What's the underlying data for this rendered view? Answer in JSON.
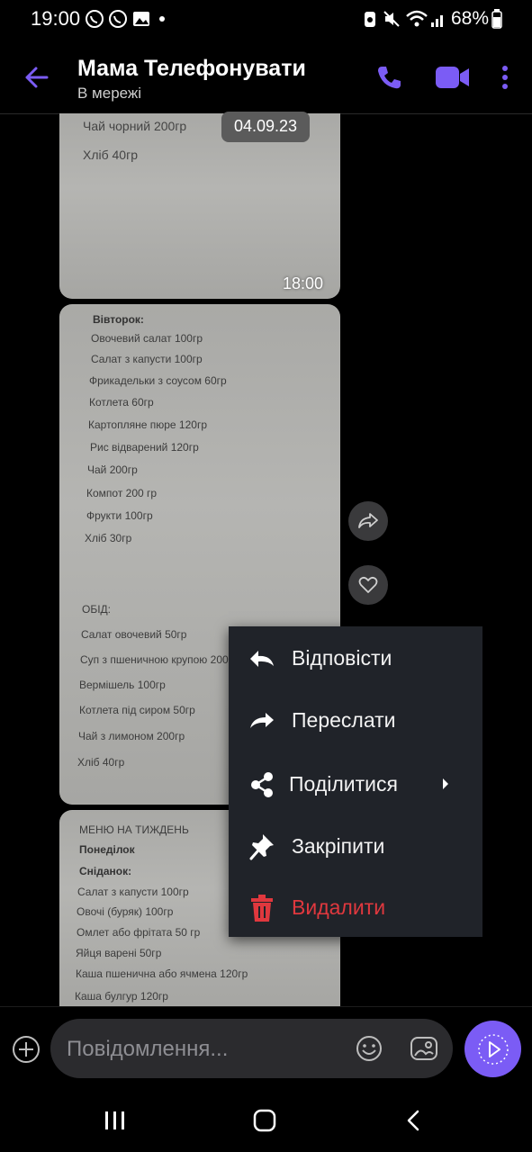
{
  "status_bar": {
    "time": "19:00",
    "battery": "68%",
    "icons": [
      "viber-icon",
      "viber-icon",
      "image-icon",
      "dot-icon",
      "recycle-icon",
      "mute-icon",
      "wifi-icon",
      "signal-icon",
      "battery-icon"
    ]
  },
  "header": {
    "contact_name": "Мама Телефонувати",
    "status": "В мережі",
    "icons": [
      "back-arrow-icon",
      "phone-icon",
      "video-call-icon",
      "more-vert-icon"
    ]
  },
  "chat": {
    "date_badge": "04.09.23",
    "photo1": {
      "lines": [
        "Чай чорний 200гр",
        "Хліб 40гр"
      ],
      "time": "18:00"
    },
    "photo2": {
      "lines": [
        "Вівторок:",
        "Овочевий салат 100гр",
        "Салат з капусти 100гр",
        "Фрикадельки з соусом 60гр",
        "Котлета 60гр",
        "Картопляне пюре 120гр",
        "Рис відварений 120гр",
        "Чай 200гр",
        "Компот 200 гр",
        "Фрукти 100гр",
        "Хліб 30гр",
        "ОБІД:",
        "Салат овочевий 50гр",
        "Суп з пшеничною крупою 200",
        "Вермішель 100гр",
        "Котлета під сиром 50гр",
        "Чай з лимоном 200гр",
        "Хліб 40гр"
      ]
    },
    "photo3": {
      "lines": [
        "МЕНЮ НА ТИЖДЕНЬ",
        "Понеділок",
        "Сніданок:",
        "Салат з капусти 100гр",
        "Овочі (буряк) 100гр",
        "Омлет або фрітата 50 гр",
        "Яйця варені 50гр",
        "Каша пшенична або ячмена 120гр",
        "Каша булгур 120гр"
      ]
    }
  },
  "context_menu": {
    "items": [
      {
        "label": "Відповісти",
        "icon": "reply-icon"
      },
      {
        "label": "Переслати",
        "icon": "forward-icon"
      },
      {
        "label": "Поділитися",
        "icon": "share-icon"
      },
      {
        "label": "Закріпити",
        "icon": "pin-icon"
      },
      {
        "label": "Видалити",
        "icon": "trash-icon"
      }
    ],
    "danger_color": "#e0383e"
  },
  "composer": {
    "placeholder": "Повідомлення...",
    "accent_color": "#7b5cf5"
  }
}
